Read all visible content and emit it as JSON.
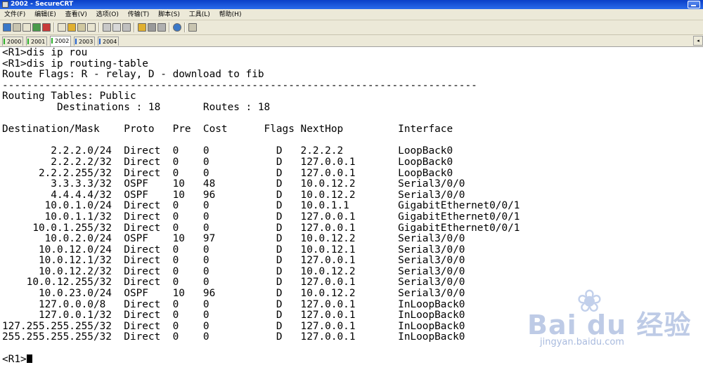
{
  "window": {
    "title": "2002 - SecureCRT"
  },
  "menu": [
    {
      "label": "文件(F)",
      "name": "menu-file"
    },
    {
      "label": "编辑(E)",
      "name": "menu-edit"
    },
    {
      "label": "查看(V)",
      "name": "menu-view"
    },
    {
      "label": "选项(O)",
      "name": "menu-options"
    },
    {
      "label": "传输(T)",
      "name": "menu-transfer"
    },
    {
      "label": "脚本(S)",
      "name": "menu-script"
    },
    {
      "label": "工具(L)",
      "name": "menu-tools"
    },
    {
      "label": "帮助(H)",
      "name": "menu-help"
    }
  ],
  "toolbar": {
    "icons": [
      "connect-icon",
      "quick-connect-icon",
      "connect-tab-icon",
      "reconnect-icon",
      "disconnect-icon",
      "copy-icon",
      "paste-icon",
      "copy-paste-icon",
      "find-icon",
      "print-icon",
      "print-selection-icon",
      "print-setup-icon",
      "session-options-icon",
      "global-options-icon",
      "keymap-icon",
      "help-icon",
      "sftp-icon"
    ],
    "accent_colors": [
      "#3a78c8",
      "#c83a3a",
      "#e0b030",
      "#4a9a4a"
    ]
  },
  "tabs": [
    {
      "label": "2000",
      "active": false,
      "dot_color": "#2bb02b"
    },
    {
      "label": "2001",
      "active": false,
      "dot_color": "#2bb02b"
    },
    {
      "label": "2002",
      "active": true,
      "dot_color": "#2bb02b"
    },
    {
      "label": "2003",
      "active": false,
      "dot_color": "#2060d0"
    },
    {
      "label": "2004",
      "active": false,
      "dot_color": "#2060d0"
    }
  ],
  "terminal": {
    "header_lines": [
      "<R1>dis ip rou",
      "<R1>dis ip routing-table",
      "Route Flags: R - relay, D - download to fib",
      "------------------------------------------------------------------------------",
      "Routing Tables: Public",
      "         Destinations : 18       Routes : 18",
      "",
      "Destination/Mask    Proto   Pre  Cost      Flags NextHop         Interface",
      ""
    ],
    "routes": [
      "        2.2.2.0/24  Direct  0    0           D   2.2.2.2         LoopBack0",
      "        2.2.2.2/32  Direct  0    0           D   127.0.0.1       LoopBack0",
      "      2.2.2.255/32  Direct  0    0           D   127.0.0.1       LoopBack0",
      "        3.3.3.3/32  OSPF    10   48          D   10.0.12.2       Serial3/0/0",
      "        4.4.4.4/32  OSPF    10   96          D   10.0.12.2       Serial3/0/0",
      "       10.0.1.0/24  Direct  0    0           D   10.0.1.1        GigabitEthernet0/0/1",
      "       10.0.1.1/32  Direct  0    0           D   127.0.0.1       GigabitEthernet0/0/1",
      "     10.0.1.255/32  Direct  0    0           D   127.0.0.1       GigabitEthernet0/0/1",
      "       10.0.2.0/24  OSPF    10   97          D   10.0.12.2       Serial3/0/0",
      "      10.0.12.0/24  Direct  0    0           D   10.0.12.1       Serial3/0/0",
      "      10.0.12.1/32  Direct  0    0           D   127.0.0.1       Serial3/0/0",
      "      10.0.12.2/32  Direct  0    0           D   10.0.12.2       Serial3/0/0",
      "    10.0.12.255/32  Direct  0    0           D   127.0.0.1       Serial3/0/0",
      "      10.0.23.0/24  OSPF    10   96          D   10.0.12.2       Serial3/0/0",
      "      127.0.0.0/8   Direct  0    0           D   127.0.0.1       InLoopBack0",
      "      127.0.0.1/32  Direct  0    0           D   127.0.0.1       InLoopBack0",
      "127.255.255.255/32  Direct  0    0           D   127.0.0.1       InLoopBack0",
      "255.255.255.255/32  Direct  0    0           D   127.0.0.1       InLoopBack0"
    ],
    "blank_after_routes": "",
    "prompt": "<R1>"
  },
  "watermark": {
    "brand": "Bai du 经验",
    "sub": "jingyan.baidu.com"
  }
}
